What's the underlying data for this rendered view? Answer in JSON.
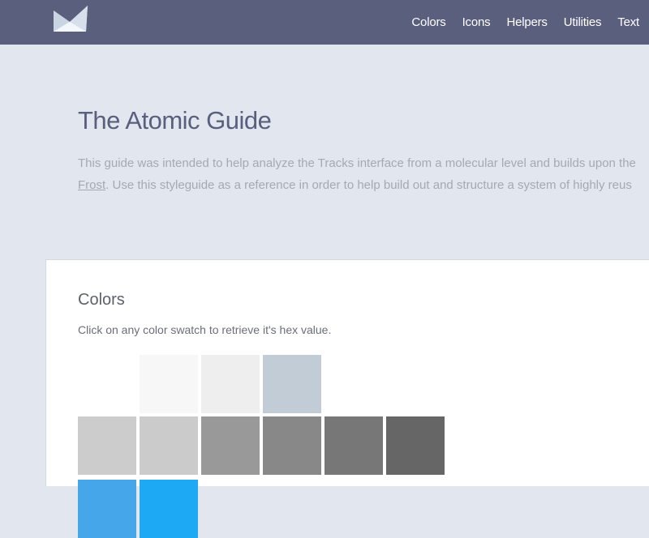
{
  "header": {
    "logo": "paper-plane-logo",
    "nav": [
      "Colors",
      "Icons",
      "Helpers",
      "Utilities",
      "Text"
    ],
    "background": "#5b5f7e"
  },
  "hero": {
    "title": "The Atomic Guide",
    "line1": "This guide was intended to help analyze the Tracks interface from a molecular level and builds upon the",
    "line2_link": "Frost",
    "line2_rest": ". Use this styleguide as a reference in order to help build out and structure a system of highly reus"
  },
  "colors_section": {
    "title": "Colors",
    "description": "Click on any color swatch to retrieve it's hex value.",
    "rows": [
      [
        "#ffffff",
        "#f7f7f7",
        "#eeeeee",
        "#c1ccd6"
      ],
      [
        "#cccccc",
        "#cbcbcb",
        "#999999",
        "#888888",
        "#777777",
        "#666666"
      ],
      [
        "#45a7ea",
        "#1da9f3"
      ]
    ]
  }
}
